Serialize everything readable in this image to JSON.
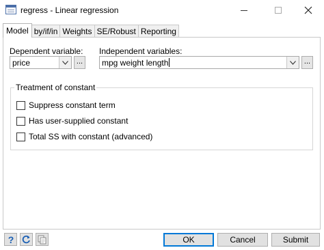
{
  "window": {
    "title": "regress - Linear regression"
  },
  "tabs": [
    {
      "label": "Model",
      "active": true
    },
    {
      "label": "by/if/in",
      "active": false
    },
    {
      "label": "Weights",
      "active": false
    },
    {
      "label": "SE/Robust",
      "active": false
    },
    {
      "label": "Reporting",
      "active": false
    }
  ],
  "model": {
    "dependent_label": "Dependent variable:",
    "dependent_value": "price",
    "independent_label": "Independent variables:",
    "independent_value": "mpg weight length",
    "browse_label": "..."
  },
  "constant_group": {
    "title": "Treatment of constant",
    "options": [
      {
        "label": "Suppress constant term",
        "checked": false
      },
      {
        "label": "Has user-supplied constant",
        "checked": false
      },
      {
        "label": "Total SS with constant (advanced)",
        "checked": false
      }
    ]
  },
  "footer": {
    "help_icon": "question-icon",
    "reset_icon": "refresh-icon",
    "copy_icon": "copy-icon",
    "ok_label": "OK",
    "cancel_label": "Cancel",
    "submit_label": "Submit"
  },
  "colors": {
    "accent": "#0078d7",
    "help_icon": "#1a5fb4"
  }
}
